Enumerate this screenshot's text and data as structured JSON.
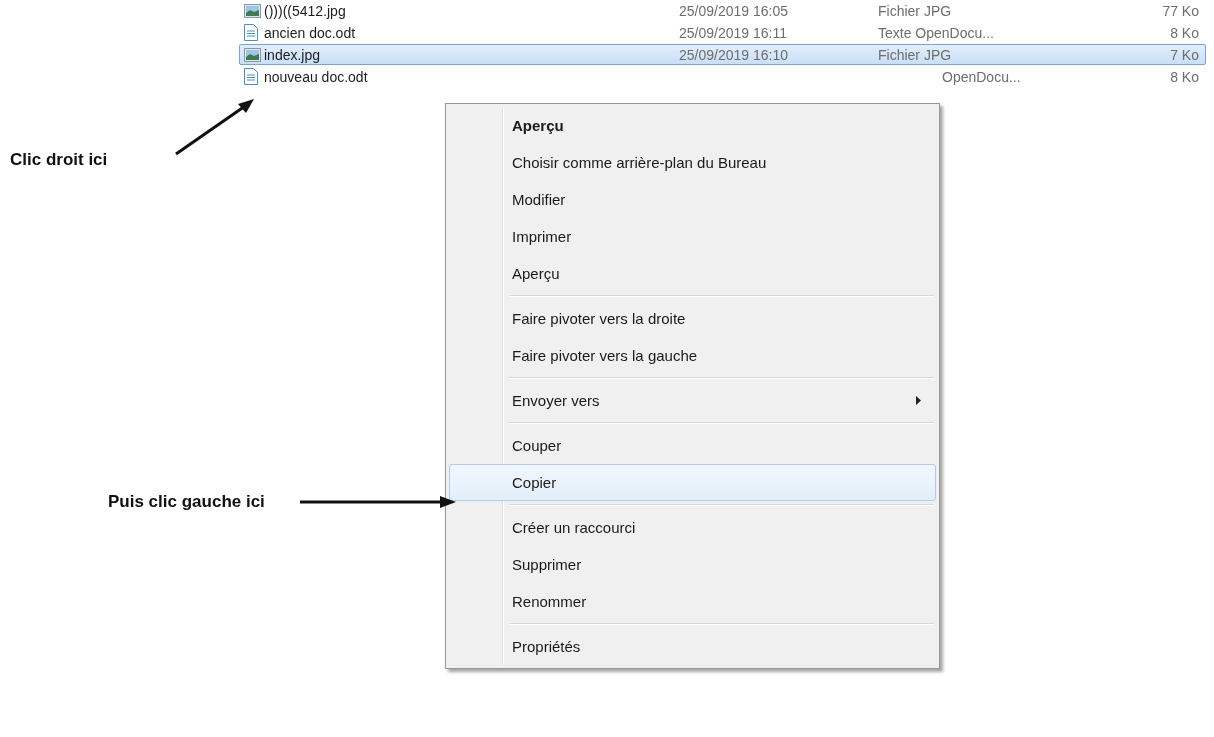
{
  "files": [
    {
      "kind": "image",
      "name": "()))((5412.jpg",
      "date": "25/09/2019 16:05",
      "type": "Fichier JPG",
      "size": "77 Ko",
      "selected": false
    },
    {
      "kind": "document",
      "name": "ancien doc.odt",
      "date": "25/09/2019 16:11",
      "type": "Texte OpenDocu...",
      "size": "8 Ko",
      "selected": false
    },
    {
      "kind": "image",
      "name": "index.jpg",
      "date": "25/09/2019 16:10",
      "type": "Fichier JPG",
      "size": "7 Ko",
      "selected": true
    },
    {
      "kind": "document",
      "name": "nouveau doc.odt",
      "type": "OpenDocu...",
      "size": "8 Ko",
      "selected": false
    }
  ],
  "context_menu": [
    {
      "kind": "item",
      "label": "Aperçu",
      "default": true,
      "submenu": false,
      "selected": false
    },
    {
      "kind": "item",
      "label": "Choisir comme arrière-plan du Bureau",
      "default": false,
      "submenu": false,
      "selected": false
    },
    {
      "kind": "item",
      "label": "Modifier",
      "default": false,
      "submenu": false,
      "selected": false
    },
    {
      "kind": "item",
      "label": "Imprimer",
      "default": false,
      "submenu": false,
      "selected": false
    },
    {
      "kind": "item",
      "label": "Aperçu",
      "default": false,
      "submenu": false,
      "selected": false
    },
    {
      "kind": "separator"
    },
    {
      "kind": "item",
      "label": "Faire pivoter vers la droite",
      "default": false,
      "submenu": false,
      "selected": false
    },
    {
      "kind": "item",
      "label": "Faire pivoter vers la gauche",
      "default": false,
      "submenu": false,
      "selected": false
    },
    {
      "kind": "separator"
    },
    {
      "kind": "item",
      "label": "Envoyer vers",
      "default": false,
      "submenu": true,
      "selected": false
    },
    {
      "kind": "separator"
    },
    {
      "kind": "item",
      "label": "Couper",
      "default": false,
      "submenu": false,
      "selected": false
    },
    {
      "kind": "item",
      "label": "Copier",
      "default": false,
      "submenu": false,
      "selected": true
    },
    {
      "kind": "separator"
    },
    {
      "kind": "item",
      "label": "Créer un raccourci",
      "default": false,
      "submenu": false,
      "selected": false
    },
    {
      "kind": "item",
      "label": "Supprimer",
      "default": false,
      "submenu": false,
      "selected": false
    },
    {
      "kind": "item",
      "label": "Renommer",
      "default": false,
      "submenu": false,
      "selected": false
    },
    {
      "kind": "separator"
    },
    {
      "kind": "item",
      "label": "Propriétés",
      "default": false,
      "submenu": false,
      "selected": false
    }
  ],
  "annotations": [
    {
      "kind": "right_click",
      "text": "Clic droit ici"
    },
    {
      "kind": "left_click",
      "text": "Puis clic gauche ici"
    }
  ]
}
